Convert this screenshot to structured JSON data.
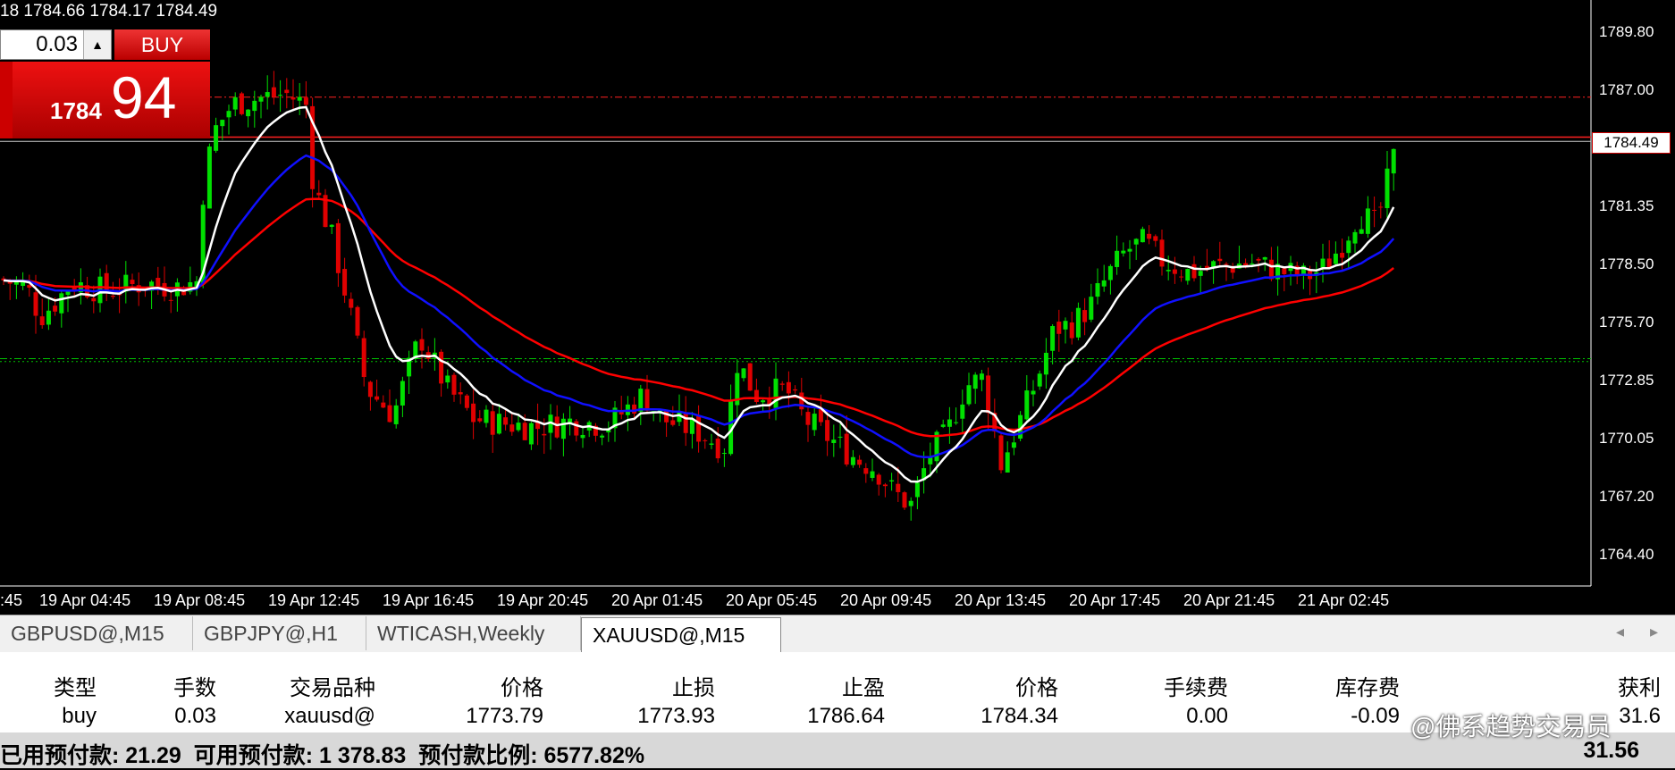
{
  "chart": {
    "ohlc_text": "18 1784.66 1784.17 1784.49",
    "current_price": "1784.49",
    "price_labels": [
      "1789.80",
      "1787.00",
      "1781.35",
      "1778.50",
      "1775.70",
      "1772.85",
      "1770.05",
      "1767.20",
      "1764.40"
    ],
    "time_labels": [
      ":45",
      "19 Apr 04:45",
      "19 Apr 08:45",
      "19 Apr 12:45",
      "19 Apr 16:45",
      "19 Apr 20:45",
      "20 Apr 01:45",
      "20 Apr 05:45",
      "20 Apr 09:45",
      "20 Apr 13:45",
      "20 Apr 17:45",
      "20 Apr 21:45",
      "21 Apr 02:45"
    ],
    "colors": {
      "bull": "#00e000",
      "bear": "#e00000",
      "ma_fast": "#ffffff",
      "ma_mid": "#1010ff",
      "ma_slow": "#ff0000",
      "level_red": "#ff2020",
      "level_green": "#00c000"
    }
  },
  "trade_panel": {
    "lot_value": "0.03",
    "buy_label": "BUY",
    "buy_price_prefix": "1784",
    "buy_price_suffix": "94",
    "up_arrow": "▲"
  },
  "tabs": [
    {
      "label": "GBPUSD@,M15"
    },
    {
      "label": "GBPJPY@,H1"
    },
    {
      "label": "WTICASH,Weekly"
    },
    {
      "label": "XAUUSD@,M15",
      "active": true
    }
  ],
  "tab_scroll": {
    "left": "◂",
    "right": "▸"
  },
  "table": {
    "headers": [
      "类型",
      "手数",
      "交易品种",
      "价格",
      "止损",
      "止盈",
      "价格",
      "手续费",
      "库存费",
      "获利"
    ],
    "row": [
      "buy",
      "0.03",
      "xauusd@",
      "1773.79",
      "1773.93",
      "1786.64",
      "1784.34",
      "0.00",
      "-0.09",
      "31.6"
    ]
  },
  "status": {
    "text": "已用预付款: 21.29  可用预付款: 1 378.83  预付款比例: 6577.82%",
    "profit": "31.56"
  },
  "watermark": "@佛系趋势交易员"
}
